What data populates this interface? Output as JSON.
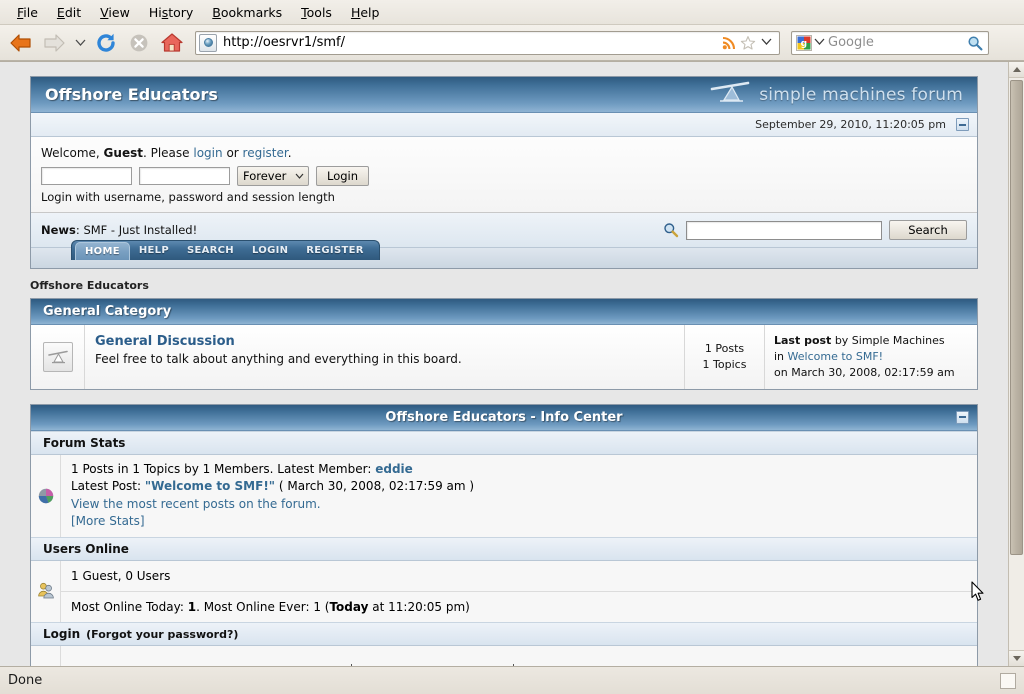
{
  "browser": {
    "menus": [
      {
        "label": "File",
        "mnemonic": "F"
      },
      {
        "label": "Edit",
        "mnemonic": "E"
      },
      {
        "label": "View",
        "mnemonic": "V"
      },
      {
        "label": "History",
        "mnemonic": "s"
      },
      {
        "label": "Bookmarks",
        "mnemonic": "B"
      },
      {
        "label": "Tools",
        "mnemonic": "T"
      },
      {
        "label": "Help",
        "mnemonic": "H"
      }
    ],
    "toolbar": {
      "back_icon": "back-arrow-icon",
      "forward_icon": "forward-arrow-icon",
      "dropmarker_icon": "chevron-down-icon",
      "reload_icon": "reload-icon",
      "stop_icon": "stop-icon",
      "home_icon": "home-icon"
    },
    "url": "http://oesrvr1/smf/",
    "url_icons": {
      "favicon": "site-favicon-icon",
      "feed": "rss-feed-icon",
      "bookmark": "star-icon",
      "history_drop": "chevron-down-icon"
    },
    "search": {
      "engine": "google-icon",
      "placeholder": "Google",
      "go_icon": "magnifier-icon",
      "engine_drop": "chevron-down-icon"
    },
    "status": "Done",
    "resize_grip": "resize-grip-icon",
    "scrollbar": {
      "up_icon": "scroll-up-arrow-icon",
      "down_icon": "scroll-down-arrow-icon",
      "thumb_percent": "83"
    }
  },
  "forum": {
    "title": "Offshore Educators",
    "logo_text": "simple machines forum",
    "logo_icon": "simple-machines-lever-icon",
    "datetime": "September 29, 2010, 11:20:05 pm",
    "collapse_icon": "collapse-minus-icon",
    "login_band": {
      "welcome_prefix": "Welcome,",
      "user": "Guest",
      "please": ". Please",
      "login_link": "login",
      "or": "or",
      "register_link": "register",
      "period": ".",
      "username_value": "",
      "password_value": "",
      "session_length": "Forever",
      "login_button": "Login",
      "hint": "Login with username, password and session length"
    },
    "news": {
      "label": "News",
      "separator": ":",
      "text": "SMF - Just Installed!",
      "search_icon": "magnifier-icon",
      "search_value": "",
      "search_button": "Search"
    },
    "tabs": [
      {
        "label": "HOME",
        "active": true
      },
      {
        "label": "HELP",
        "active": false
      },
      {
        "label": "SEARCH",
        "active": false
      },
      {
        "label": "LOGIN",
        "active": false
      },
      {
        "label": "REGISTER",
        "active": false
      }
    ],
    "breadcrumb": "Offshore Educators",
    "category": {
      "name": "General Category",
      "board": {
        "icon": "board-lever-icon",
        "name": "General Discussion",
        "description": "Feel free to talk about anything and everything in this board.",
        "posts": "1 Posts",
        "topics": "1 Topics",
        "last_post_label": "Last post",
        "last_post_by": "by Simple Machines",
        "last_post_in_prefix": "in",
        "last_post_topic": "Welcome to SMF!",
        "last_post_date": "on March 30, 2008, 02:17:59 am"
      }
    },
    "info_center": {
      "title": "Offshore Educators - Info Center",
      "collapse_icon": "collapse-minus-icon",
      "forum_stats": {
        "heading": "Forum Stats",
        "icon": "pie-chart-icon",
        "line1": "1 Posts in 1 Topics by 1 Members. Latest Member:",
        "latest_member": "eddie",
        "line2_prefix": "Latest Post:",
        "latest_post_title": "\"Welcome to SMF!\"",
        "latest_post_date": "( March 30, 2008, 02:17:59 am )",
        "view_recent": "View the most recent posts on the forum.",
        "more_stats": "[More Stats]"
      },
      "users_online": {
        "heading": "Users Online",
        "icon": "users-group-icon",
        "line1": "1 Guest, 0 Users",
        "most_today_prefix": "Most Online Today:",
        "most_today": "1",
        "most_ever_prefix": ". Most Online Ever: 1 (",
        "most_ever_day": "Today",
        "most_ever_suffix": " at 11:20:05 pm)"
      },
      "login_section": {
        "heading": "Login",
        "sub": "(Forgot your password?)"
      }
    }
  }
}
